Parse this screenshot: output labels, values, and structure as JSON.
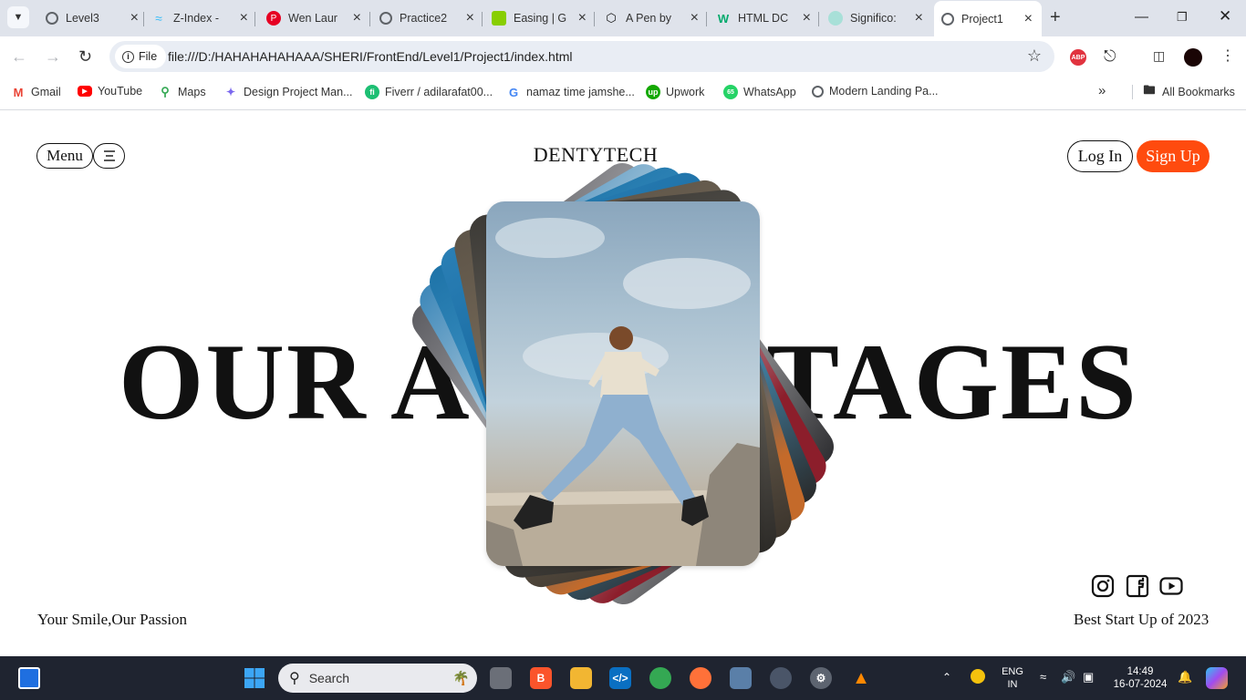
{
  "browser": {
    "tabs": [
      {
        "title": "Level3",
        "favicon": "globe-icon",
        "color": "#5f6368"
      },
      {
        "title": "Z-Index -",
        "favicon": "tailwind-icon",
        "color": "#38bdf8"
      },
      {
        "title": "Wen Laur",
        "favicon": "pinterest-icon",
        "color": "#e60023"
      },
      {
        "title": "Practice2",
        "favicon": "globe-icon",
        "color": "#5f6368"
      },
      {
        "title": "Easing | G",
        "favicon": "greensock-icon",
        "color": "#88ce02"
      },
      {
        "title": "A Pen by",
        "favicon": "codepen-icon",
        "color": "#111111"
      },
      {
        "title": "HTML DC",
        "favicon": "w3schools-icon",
        "color": "#04aa6d"
      },
      {
        "title": "Significo:",
        "favicon": "site-icon",
        "color": "#a8e0d8"
      },
      {
        "title": "Project1",
        "favicon": "globe-icon",
        "color": "#5f6368"
      }
    ],
    "address": {
      "scheme_label": "File",
      "url": "file:///D:/HAHAHAHAHAAA/SHERI/FrontEnd/Level1/Project1/index.html"
    },
    "abp_label": "ABP",
    "bookmarks": [
      {
        "label": "Gmail",
        "icon": "gmail-icon",
        "color": "#ea4335"
      },
      {
        "label": "YouTube",
        "icon": "youtube-icon",
        "color": "#ff0000"
      },
      {
        "label": "Maps",
        "icon": "maps-icon",
        "color": "#34a853"
      },
      {
        "label": "Design Project Man...",
        "icon": "clickup-icon",
        "color": "#7b68ee"
      },
      {
        "label": "Fiverr / adilarafat00...",
        "icon": "fiverr-icon",
        "color": "#1dbf73"
      },
      {
        "label": "namaz time jamshe...",
        "icon": "google-icon",
        "color": "#4285f4"
      },
      {
        "label": "Upwork",
        "icon": "upwork-icon",
        "color": "#14a800"
      },
      {
        "label": "WhatsApp",
        "icon": "whatsapp-icon",
        "color": "#25d366"
      },
      {
        "label": "Modern Landing Pa...",
        "icon": "globe-icon",
        "color": "#5f6368"
      }
    ],
    "all_bookmarks_label": "All Bookmarks"
  },
  "site": {
    "menu_label": "Menu",
    "brand": "DENTYTECH",
    "login_label": "Log In",
    "signup_label": "Sign Up",
    "headline_left": "OUR A",
    "headline_right": "TAGES",
    "tagline_left": "Your Smile,Our Passion",
    "tagline_right": "Best Start Up of 2023",
    "accent_color": "#ff4b0e",
    "social_icons": [
      "instagram-icon",
      "facebook-icon",
      "youtube-icon"
    ]
  },
  "taskbar": {
    "search_placeholder": "Search",
    "lang_line1": "ENG",
    "lang_line2": "IN",
    "time": "14:49",
    "date": "16-07-2024"
  }
}
